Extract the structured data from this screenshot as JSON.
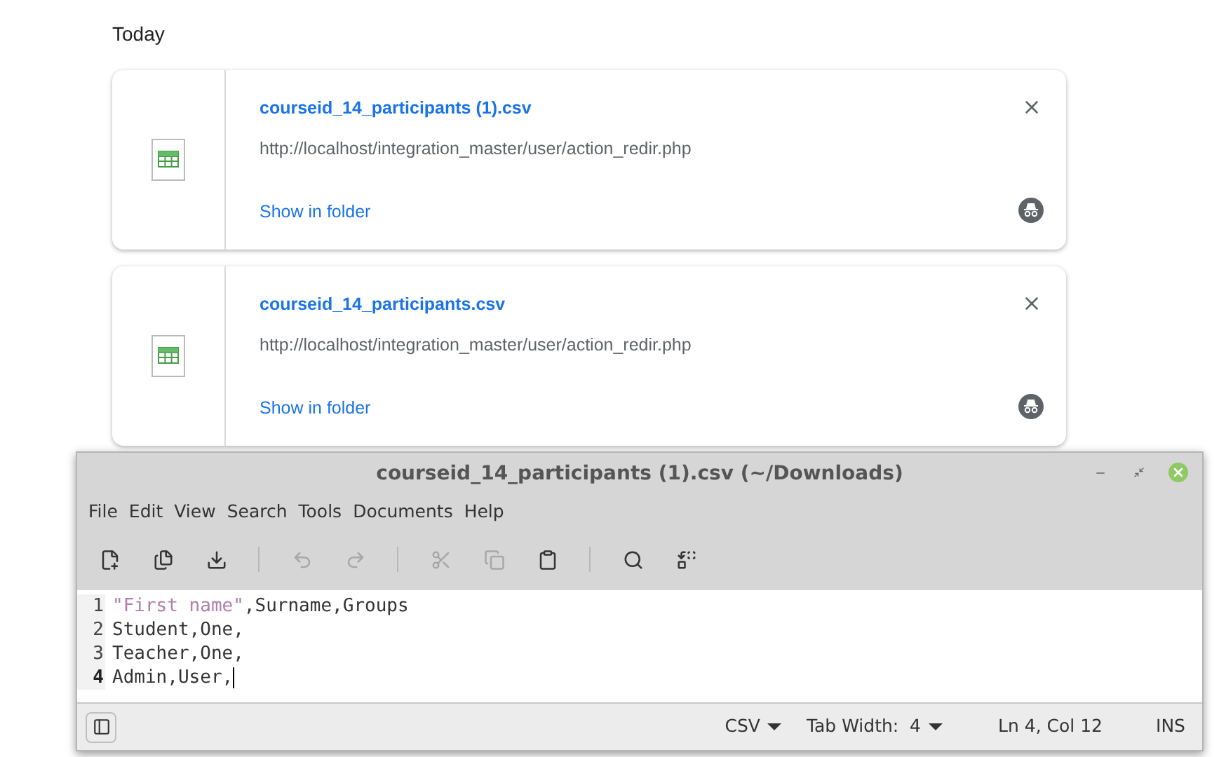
{
  "section_title": "Today",
  "downloads": [
    {
      "file_name": "courseid_14_participants (1).csv",
      "url": "http://localhost/integration_master/user/action_redir.php",
      "action": "Show in folder"
    },
    {
      "file_name": "courseid_14_participants.csv",
      "url": "http://localhost/integration_master/user/action_redir.php",
      "action": "Show in folder"
    }
  ],
  "editor": {
    "title": "courseid_14_participants (1).csv (~/Downloads)",
    "menu": [
      "File",
      "Edit",
      "View",
      "Search",
      "Tools",
      "Documents",
      "Help"
    ],
    "toolbar": [
      {
        "kind": "new",
        "disabled": false
      },
      {
        "kind": "open",
        "disabled": false
      },
      {
        "kind": "save",
        "disabled": false
      },
      {
        "kind": "separator"
      },
      {
        "kind": "undo",
        "disabled": true
      },
      {
        "kind": "redo",
        "disabled": true
      },
      {
        "kind": "separator"
      },
      {
        "kind": "cut",
        "disabled": true
      },
      {
        "kind": "copy",
        "disabled": true
      },
      {
        "kind": "paste",
        "disabled": false
      },
      {
        "kind": "separator"
      },
      {
        "kind": "find",
        "disabled": false
      },
      {
        "kind": "replace",
        "disabled": false
      }
    ],
    "lines": [
      {
        "number": "1",
        "current": false,
        "tokens": [
          {
            "kind": "string",
            "text": "\"First name\""
          },
          {
            "kind": "plain",
            "text": ",Surname,Groups"
          }
        ]
      },
      {
        "number": "2",
        "current": false,
        "tokens": [
          {
            "kind": "plain",
            "text": "Student,One,"
          }
        ]
      },
      {
        "number": "3",
        "current": false,
        "tokens": [
          {
            "kind": "plain",
            "text": "Teacher,One,"
          }
        ]
      },
      {
        "number": "4",
        "current": true,
        "tokens": [
          {
            "kind": "plain",
            "text": "Admin,User,"
          }
        ]
      }
    ],
    "status": {
      "language": "CSV",
      "tab_width": "Tab Width:  4",
      "position": "Ln 4, Col 12",
      "mode": "INS"
    }
  }
}
